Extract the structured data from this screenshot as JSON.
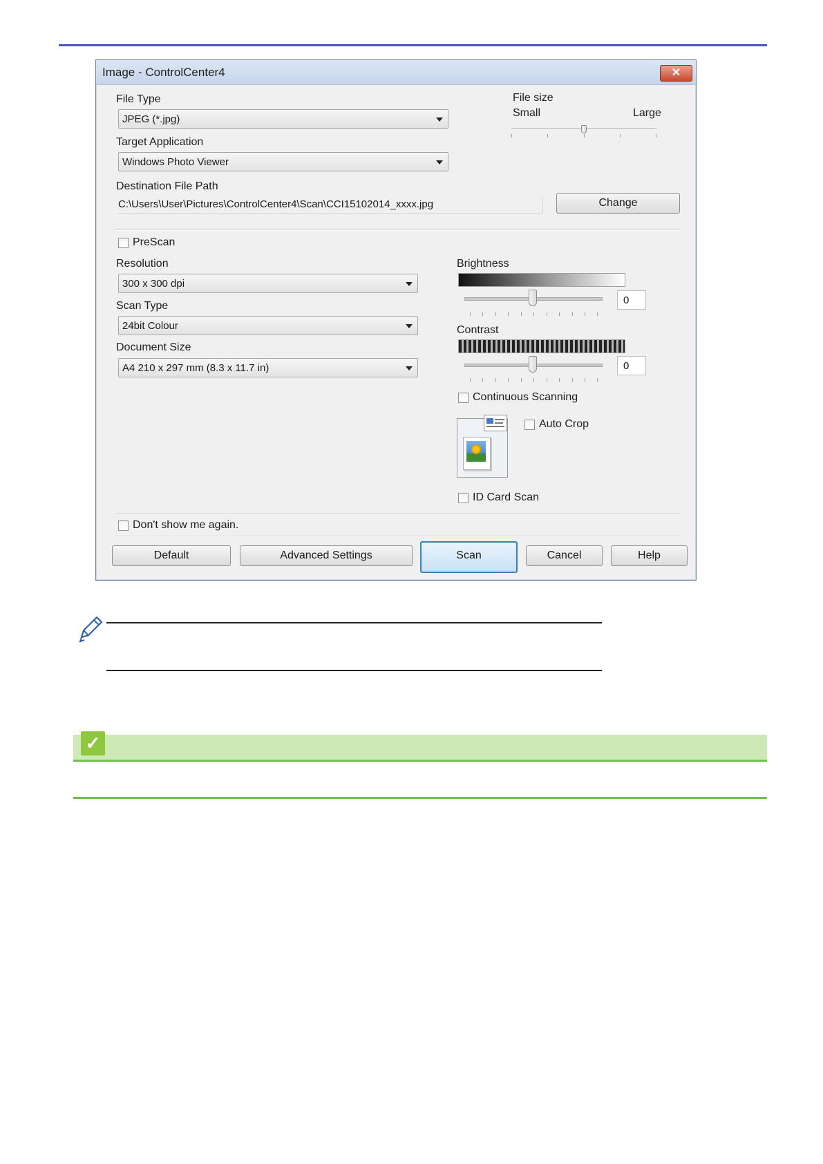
{
  "dialog": {
    "title": "Image - ControlCenter4",
    "close_label": "✕",
    "file_type": {
      "label": "File Type",
      "value": "JPEG (*.jpg)"
    },
    "target_application": {
      "label": "Target Application",
      "value": "Windows Photo Viewer"
    },
    "destination": {
      "label": "Destination File Path",
      "value": "C:\\Users\\User\\Pictures\\ControlCenter4\\Scan\\CCI15102014_xxxx.jpg",
      "change_label": "Change"
    },
    "file_size": {
      "label": "File size",
      "small_label": "Small",
      "large_label": "Large",
      "level_fraction": 0.5
    },
    "prescan": {
      "label": "PreScan",
      "checked": false
    },
    "resolution": {
      "label": "Resolution",
      "value": "300 x 300 dpi"
    },
    "scan_type": {
      "label": "Scan Type",
      "value": "24bit Colour"
    },
    "document_size": {
      "label": "Document Size",
      "value": "A4 210 x 297 mm (8.3 x 11.7 in)"
    },
    "brightness": {
      "label": "Brightness",
      "value": "0",
      "level_fraction": 0.5
    },
    "contrast": {
      "label": "Contrast",
      "value": "0",
      "level_fraction": 0.5
    },
    "continuous_scanning": {
      "label": "Continuous Scanning",
      "checked": false
    },
    "auto_crop": {
      "label": "Auto Crop",
      "checked": false
    },
    "id_card_scan": {
      "label": "ID Card Scan",
      "checked": false
    },
    "dont_show": {
      "label": "Don't show me again.",
      "checked": false
    },
    "buttons": {
      "default_label": "Default",
      "advanced_label": "Advanced Settings",
      "scan_label": "Scan",
      "cancel_label": "Cancel",
      "help_label": "Help"
    }
  },
  "colors": {
    "top_rule": "#4b4fc4",
    "green_band": "#cde9b5",
    "green_line": "#6fc24a",
    "badge": "#8fc73e"
  },
  "icons": {
    "note": "pencil-icon",
    "related": "checkmark-icon",
    "autocrop": "auto-crop-illustration-icon"
  }
}
